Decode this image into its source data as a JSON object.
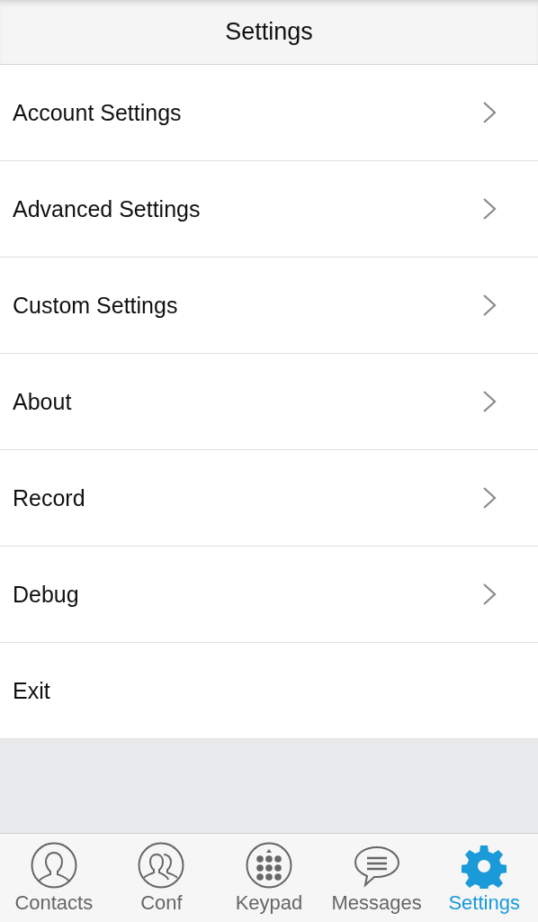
{
  "header": {
    "title": "Settings"
  },
  "items": [
    {
      "label": "Account Settings",
      "kind": "link"
    },
    {
      "label": "Advanced Settings",
      "kind": "link"
    },
    {
      "label": "Custom Settings",
      "kind": "link"
    },
    {
      "label": "About",
      "kind": "link"
    },
    {
      "label": "Record",
      "kind": "link"
    },
    {
      "label": "Debug",
      "kind": "link"
    },
    {
      "label": "Exit",
      "kind": "action"
    }
  ],
  "tabs": [
    {
      "label": "Contacts",
      "kind": "contacts",
      "selected": false
    },
    {
      "label": "Conf",
      "kind": "conf",
      "selected": false
    },
    {
      "label": "Keypad",
      "kind": "keypad",
      "selected": false
    },
    {
      "label": "Messages",
      "kind": "messages",
      "selected": false
    },
    {
      "label": "Settings",
      "kind": "settings",
      "selected": true
    }
  ]
}
